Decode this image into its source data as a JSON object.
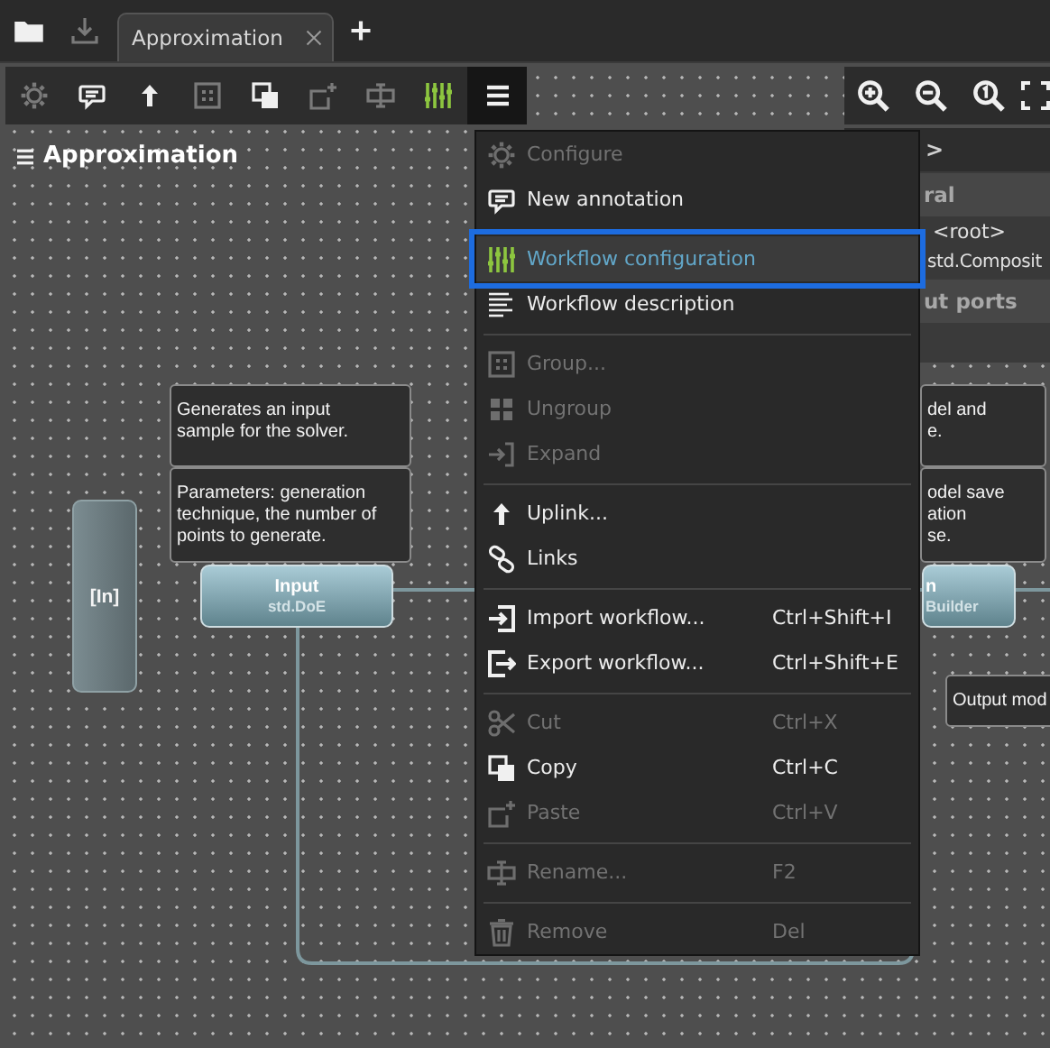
{
  "tab_bar": {
    "tabs": [
      {
        "label": "Approximation",
        "selected": true
      }
    ]
  },
  "toolbar": {
    "buttons": [
      {
        "disabled": true,
        "pressed": false
      },
      {
        "disabled": false,
        "pressed": false
      },
      {
        "disabled": false,
        "pressed": false
      },
      {
        "disabled": true,
        "pressed": false
      },
      {
        "disabled": false,
        "pressed": false
      },
      {
        "disabled": true,
        "pressed": false
      },
      {
        "disabled": true,
        "pressed": false
      },
      {
        "disabled": false,
        "pressed": false
      },
      {
        "disabled": false,
        "pressed": true
      }
    ]
  },
  "canvas": {
    "title": "Approximation",
    "annotations": [
      {
        "text": "Generates an input\nsample for the solver."
      },
      {
        "text": "Parameters: generation\ntechnique, the number of\npoints to generate."
      },
      {
        "text": "del and\ne."
      },
      {
        "text": "odel save\nation\nse."
      },
      {
        "text": "Output mod"
      }
    ],
    "blocks": [
      {
        "kind": "port",
        "title": "[In]"
      },
      {
        "kind": "block",
        "title": "Input",
        "subtitle": "std.DoE"
      },
      {
        "kind": "block",
        "title": "n",
        "subtitle": "Builder"
      }
    ]
  },
  "properties_panel": {
    "header": ">",
    "rows": [
      {
        "kind": "section",
        "text": "ral"
      },
      {
        "kind": "row",
        "text": "<root>"
      },
      {
        "kind": "row",
        "text": "std.Composit"
      },
      {
        "kind": "section",
        "text": "ut ports"
      }
    ]
  },
  "context_menu": {
    "items": [
      {
        "kind": "item",
        "label": "Configure",
        "disabled": true,
        "selected": false
      },
      {
        "kind": "item",
        "label": "New annotation",
        "disabled": false,
        "selected": false
      },
      {
        "kind": "separator"
      },
      {
        "kind": "item",
        "label": "Workflow configuration",
        "disabled": false,
        "selected": true
      },
      {
        "kind": "item",
        "label": "Workflow description",
        "disabled": false,
        "selected": false
      },
      {
        "kind": "separator"
      },
      {
        "kind": "item",
        "label": "Group...",
        "disabled": true,
        "selected": false
      },
      {
        "kind": "item",
        "label": "Ungroup",
        "disabled": true,
        "selected": false
      },
      {
        "kind": "item",
        "label": "Expand",
        "disabled": true,
        "selected": false
      },
      {
        "kind": "separator"
      },
      {
        "kind": "item",
        "label": "Uplink...",
        "disabled": false,
        "selected": false
      },
      {
        "kind": "item",
        "label": "Links",
        "disabled": false,
        "selected": false
      },
      {
        "kind": "separator"
      },
      {
        "kind": "item",
        "label": "Import workflow...",
        "shortcut": "Ctrl+Shift+I",
        "disabled": false,
        "selected": false
      },
      {
        "kind": "item",
        "label": "Export workflow...",
        "shortcut": "Ctrl+Shift+E",
        "disabled": false,
        "selected": false
      },
      {
        "kind": "separator"
      },
      {
        "kind": "item",
        "label": "Cut",
        "shortcut": "Ctrl+X",
        "disabled": true,
        "selected": false
      },
      {
        "kind": "item",
        "label": "Copy",
        "shortcut": "Ctrl+C",
        "disabled": false,
        "selected": false
      },
      {
        "kind": "item",
        "label": "Paste",
        "shortcut": "Ctrl+V",
        "disabled": true,
        "selected": false
      },
      {
        "kind": "separator"
      },
      {
        "kind": "item",
        "label": "Rename...",
        "shortcut": "F2",
        "disabled": true,
        "selected": false
      },
      {
        "kind": "separator"
      },
      {
        "kind": "item",
        "label": "Remove",
        "shortcut": "Del",
        "disabled": true,
        "selected": false
      }
    ]
  }
}
